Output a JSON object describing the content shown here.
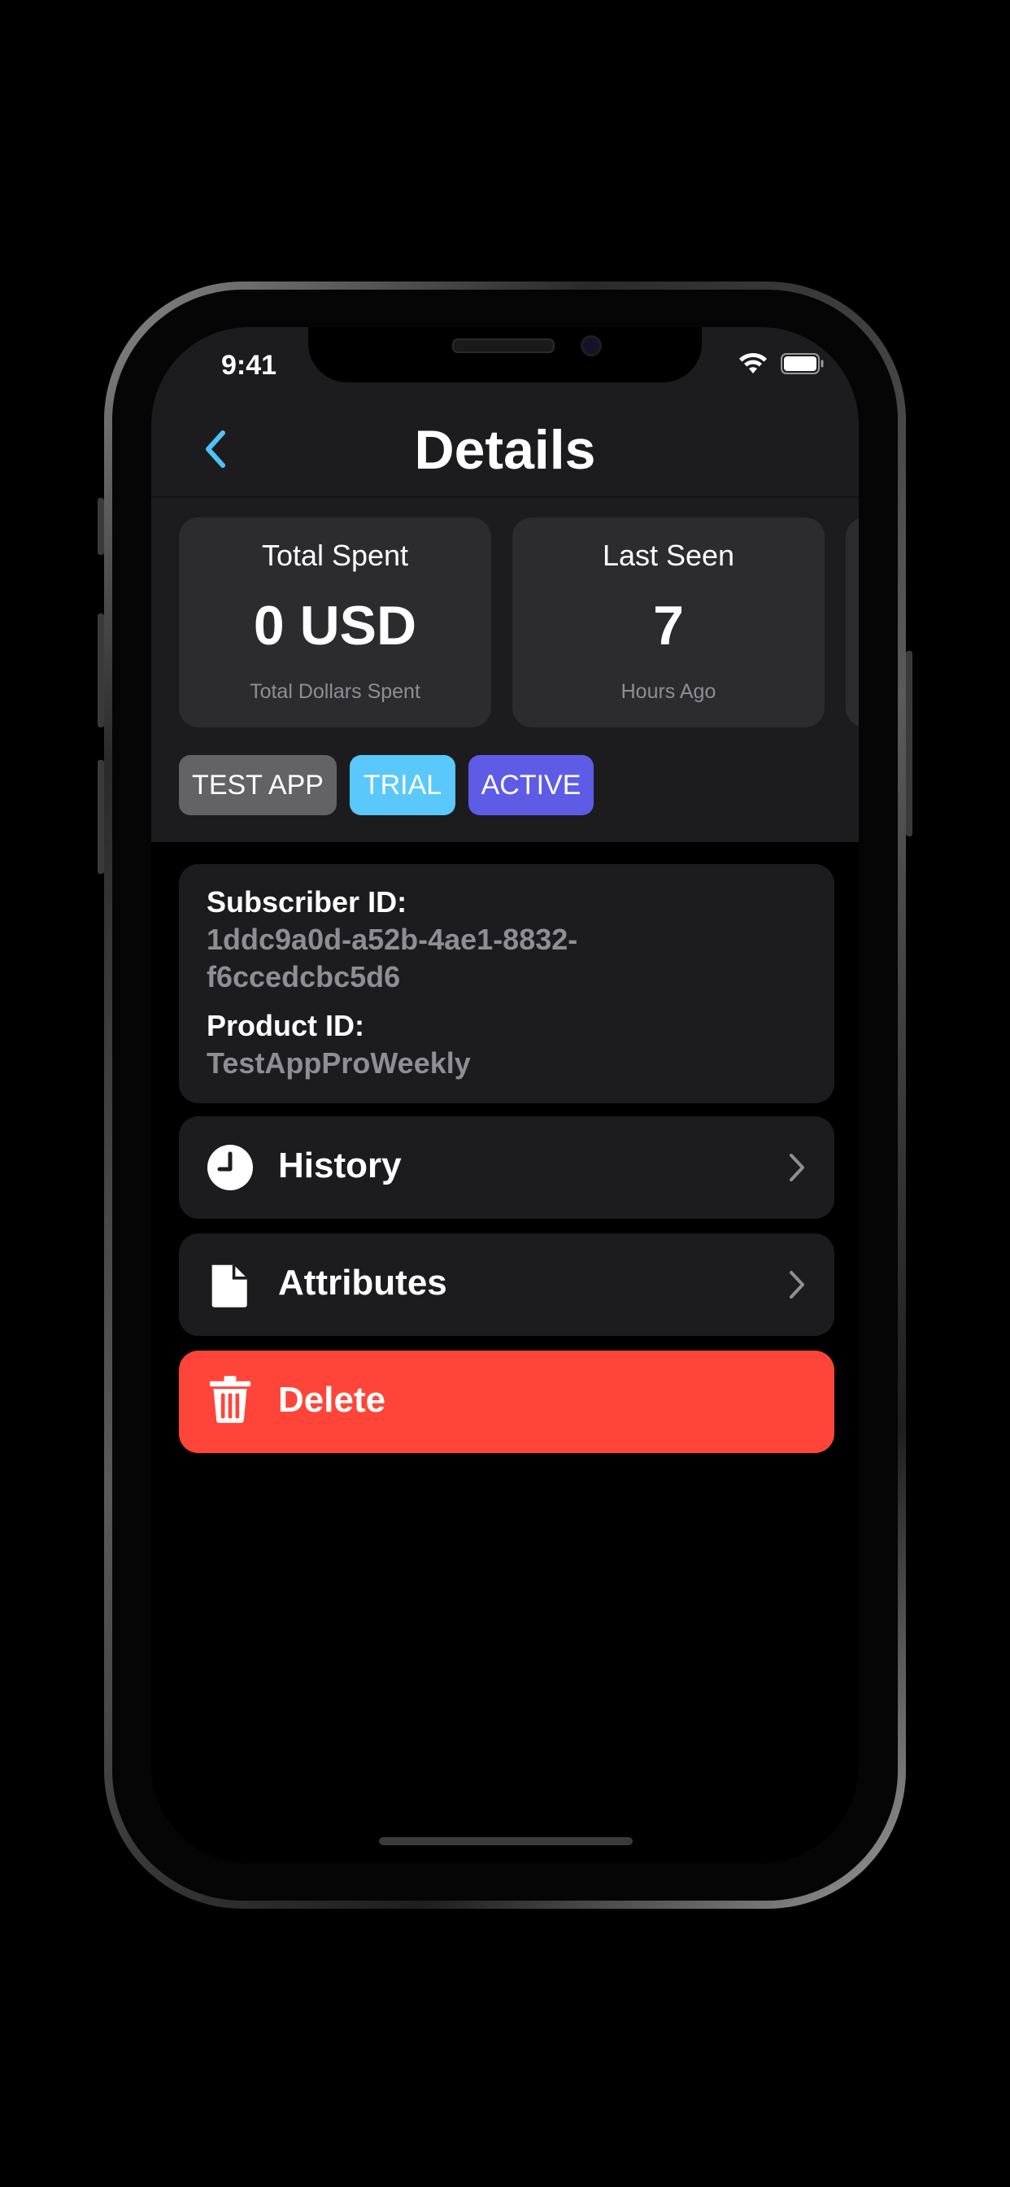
{
  "status_bar": {
    "time": "9:41"
  },
  "nav": {
    "title": "Details",
    "back_icon": "chevron-left-icon",
    "accent": "#4fc3f7"
  },
  "stats": [
    {
      "label": "Total Spent",
      "value": "0 USD",
      "sub": "Total Dollars Spent"
    },
    {
      "label": "Last Seen",
      "value": "7",
      "sub": "Hours Ago"
    }
  ],
  "badges": [
    {
      "label": "TEST APP",
      "color": "#636366"
    },
    {
      "label": "TRIAL",
      "color": "#5ac8fa"
    },
    {
      "label": "ACTIVE",
      "color": "#5e5ce6"
    }
  ],
  "subscriber": {
    "subscriber_id_label": "Subscriber ID:",
    "subscriber_id_line1": "1ddc9a0d-a52b-4ae1-8832-",
    "subscriber_id_line2": "f6ccedcbc5d6",
    "product_id_label": "Product ID:",
    "product_id_value": "TestAppProWeekly"
  },
  "actions": {
    "history_label": "History",
    "history_icon": "clock-icon",
    "attributes_label": "Attributes",
    "attributes_icon": "document-icon",
    "delete_label": "Delete",
    "delete_icon": "trash-icon",
    "delete_color": "#ff453a"
  }
}
